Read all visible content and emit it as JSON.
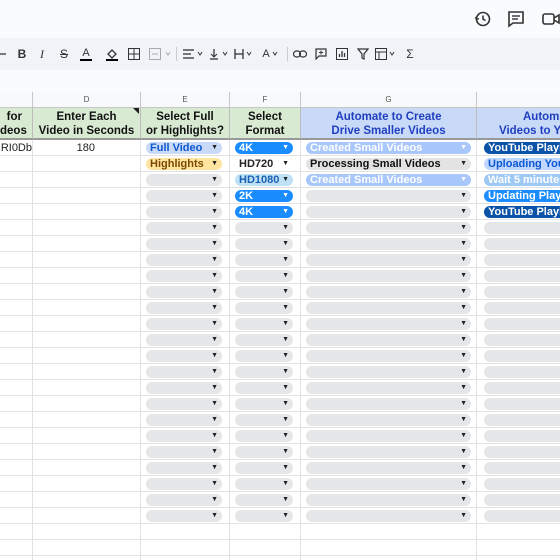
{
  "toolbar": {
    "bold": "B",
    "italic": "I",
    "strike": "S",
    "textcolor": "A",
    "textcolor2": "A",
    "sigma": "Σ"
  },
  "columns": {
    "d": "D",
    "e": "E",
    "f": "F",
    "g": "G"
  },
  "headers": {
    "c_line1": "for",
    "c_line2": "deos",
    "d_line1": "Enter Each",
    "d_line2": "Video in Seconds",
    "e_line1": "Select Full",
    "e_line2": "or Highlights?",
    "f_line1": "Select",
    "f_line2": "Format",
    "g_line1": "Automate to Create",
    "g_line2": "Drive Smaller Videos",
    "h_line1": "Autom",
    "h_line2": "Videos to Y"
  },
  "row1": {
    "c_value": "RRI0Db",
    "d_value": "180"
  },
  "column_e": [
    "Full Video",
    "Highlights"
  ],
  "column_f": [
    "4K",
    "HD720",
    "HD1080",
    "2K",
    "4K"
  ],
  "column_g": [
    "Created Small Videos",
    "Processing Small Videos",
    "Created Small Videos"
  ],
  "column_h": [
    "YouTube Playli",
    "Uploading You",
    "Wait 5 minutes",
    "Updating Playl",
    "YouTube Playli"
  ],
  "colors": {
    "header_green": "#d9ead3",
    "header_blue": "#c9daf8",
    "header_blue_text": "#1f3fbf",
    "chip_blue_light": "#c9daf8",
    "chip_yellow": "#ffe5a0",
    "chip_dark_blue": "#0a53a8",
    "chip_bright_blue": "#1a8cff",
    "chip_sky": "#bfe1f6",
    "chip_gray": "#e5e6e8"
  },
  "icons": [
    "history-icon",
    "comment-icon",
    "video-call-icon",
    "undo-icon",
    "bold-icon",
    "italic-icon",
    "strikethrough-icon",
    "text-color-icon",
    "fill-color-icon",
    "borders-icon",
    "merge-cells-icon",
    "align-icon",
    "valign-icon",
    "wrap-icon",
    "rotate-icon",
    "link-icon",
    "comment-add-icon",
    "chart-icon",
    "filter-icon",
    "filter-views-icon",
    "functions-icon"
  ]
}
